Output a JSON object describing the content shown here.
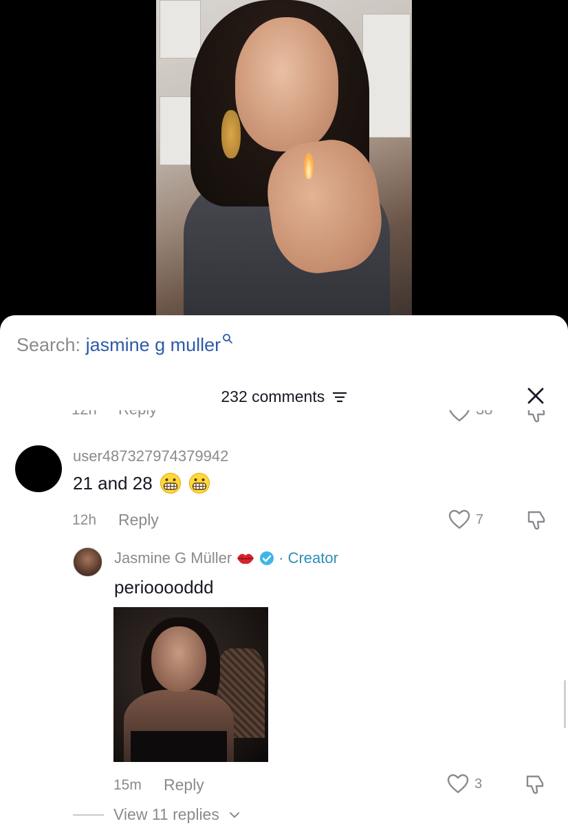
{
  "search": {
    "prefix": "Search:",
    "term": "jasmine g muller"
  },
  "header": {
    "title": "232 comments"
  },
  "partial_row": {
    "time": "12h",
    "reply": "Reply",
    "likes": "38"
  },
  "comments": [
    {
      "username": "user487327974379942",
      "text": "21 and 28",
      "emojis": [
        "grimacing-face",
        "grimacing-face"
      ],
      "time": "12h",
      "reply_label": "Reply",
      "likes": "7"
    },
    {
      "username": "Jasmine G Müller",
      "badge_emoji": "kiss-mark",
      "verified": true,
      "creator_label": "· Creator",
      "text": "periooooddd",
      "has_image": true,
      "time": "15m",
      "reply_label": "Reply",
      "likes": "3"
    }
  ],
  "view_replies": {
    "label": "View 11 replies"
  },
  "colors": {
    "link_blue": "#2d5aa8",
    "creator": "#2d8fb4",
    "muted": "#8a8a8f",
    "text": "#161823"
  }
}
